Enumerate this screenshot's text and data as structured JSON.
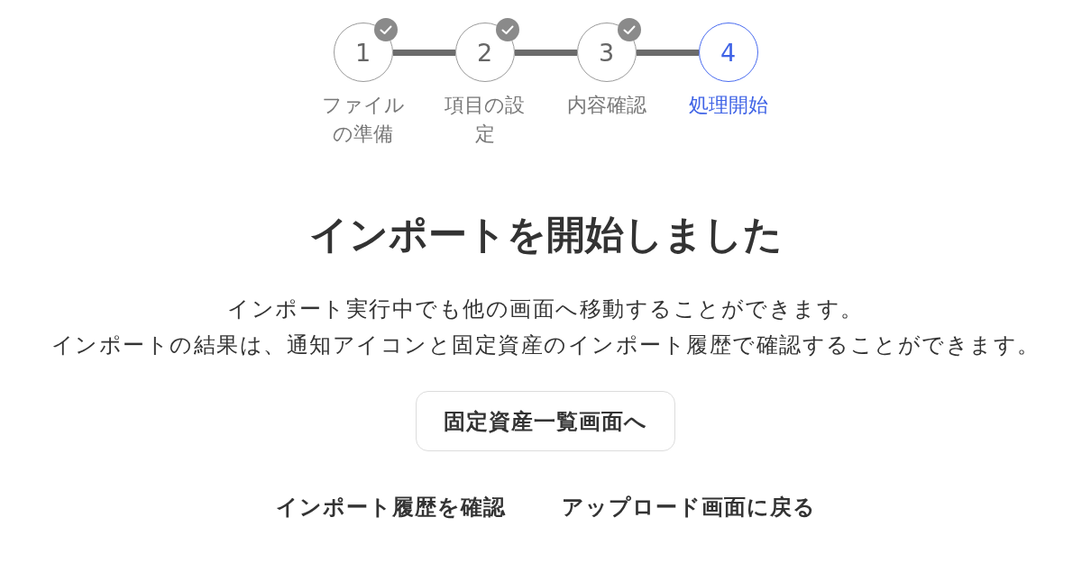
{
  "stepper": {
    "steps": [
      {
        "number": "1",
        "label": "ファイルの準備",
        "completed": true,
        "selected": false
      },
      {
        "number": "2",
        "label": "項目の設定",
        "completed": true,
        "selected": false
      },
      {
        "number": "3",
        "label": "内容確認",
        "completed": true,
        "selected": false
      },
      {
        "number": "4",
        "label": "処理開始",
        "completed": false,
        "selected": true
      }
    ]
  },
  "heading": "インポートを開始しました",
  "description": [
    "インポート実行中でも他の画面へ移動することができます。",
    "インポートの結果は、通知アイコンと固定資産のインポート履歴で確認することができます。"
  ],
  "primary_button": "固定資産一覧画面へ",
  "links": [
    "インポート履歴を確認",
    "アップロード画面に戻る"
  ]
}
